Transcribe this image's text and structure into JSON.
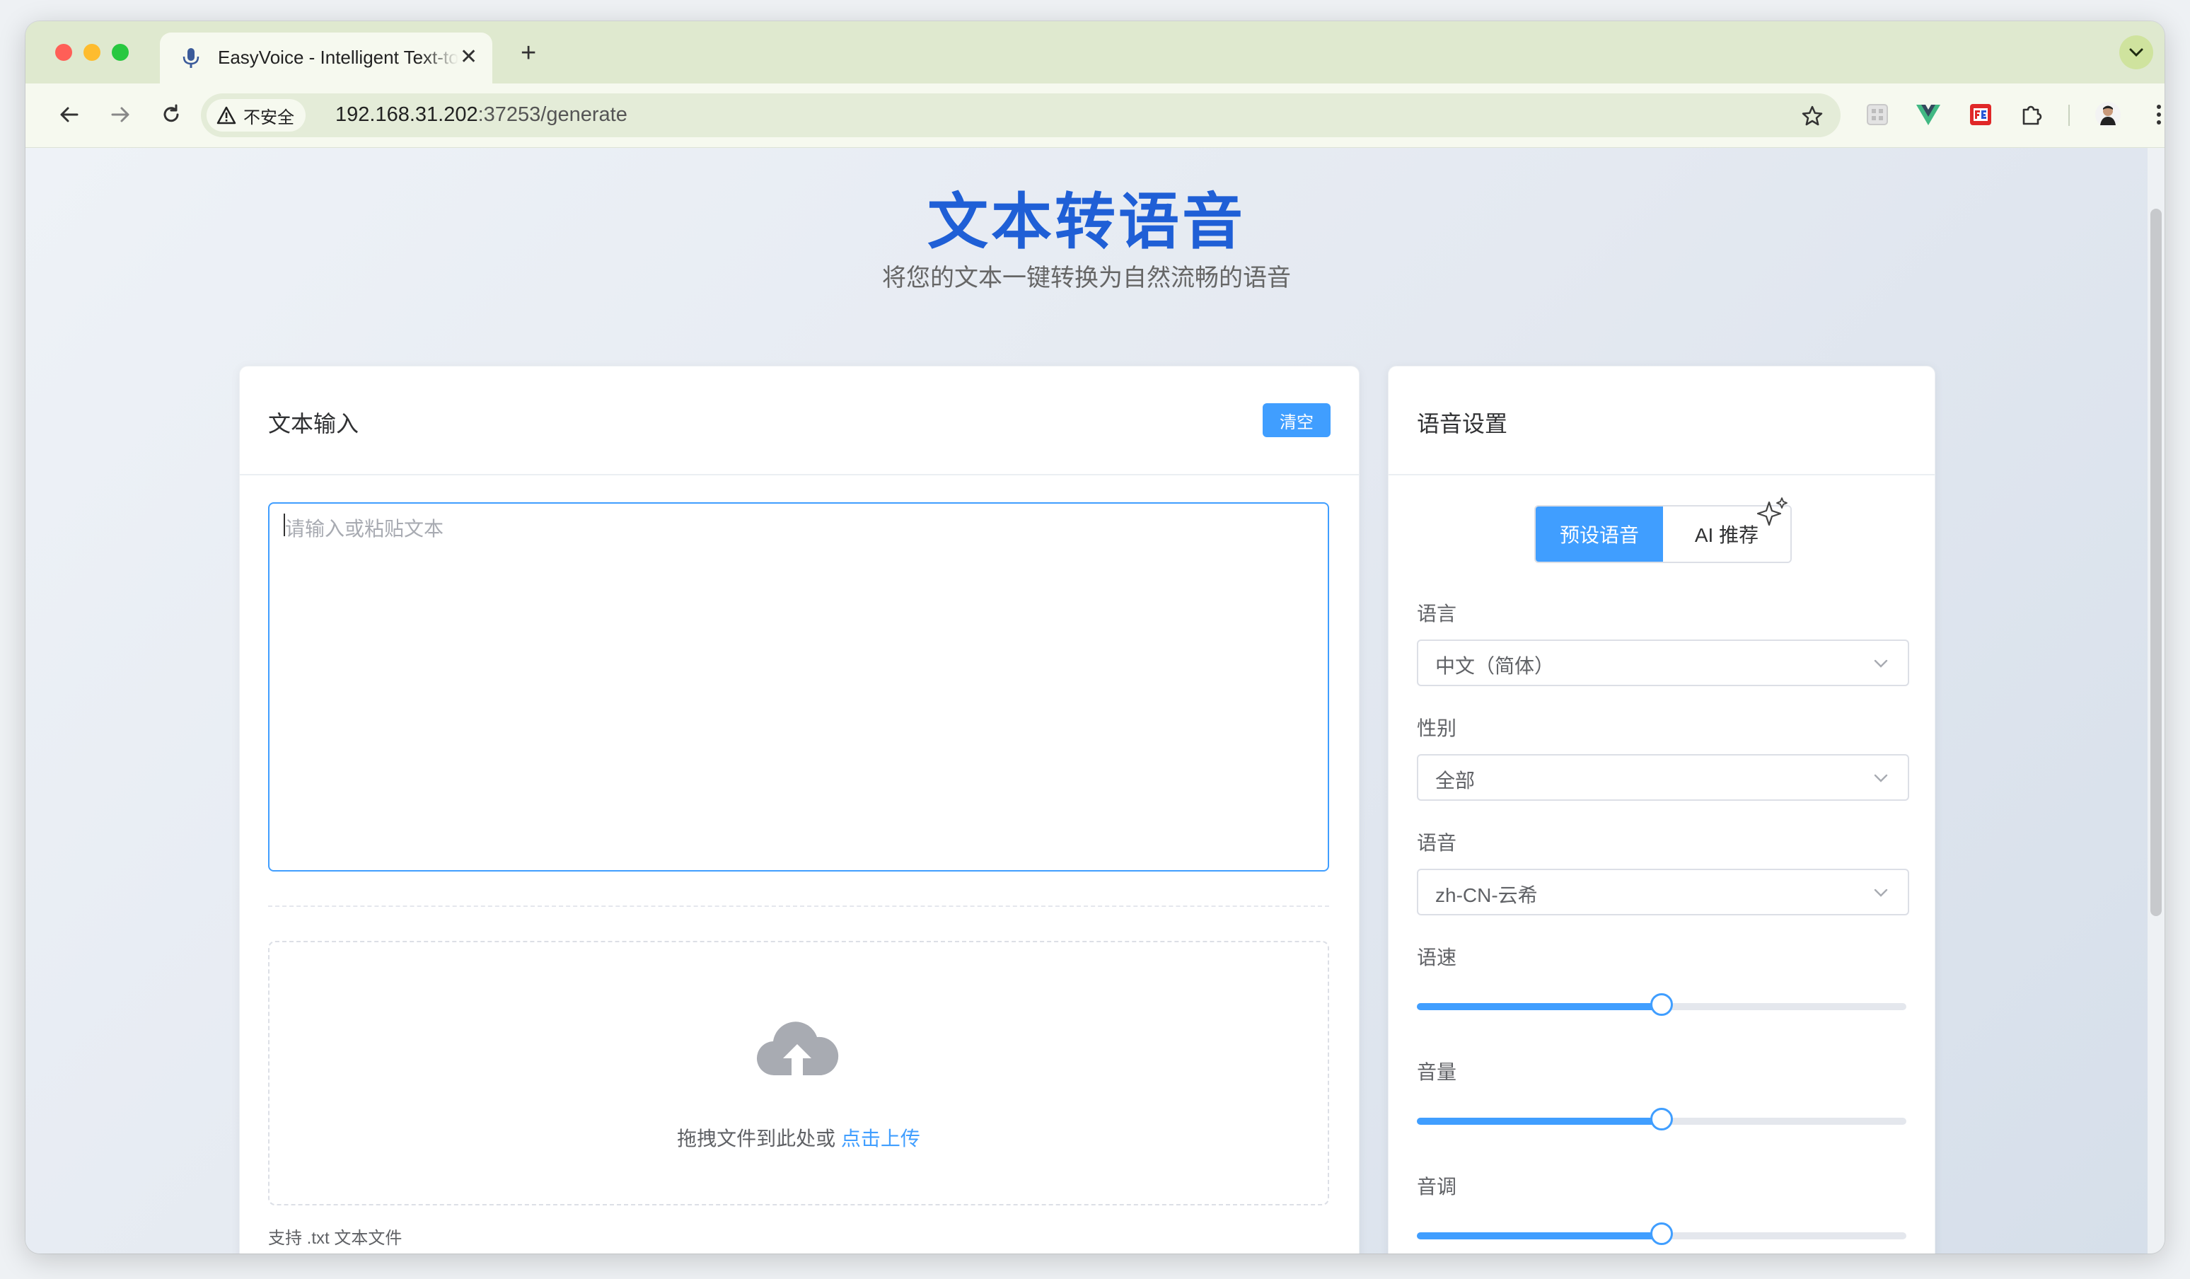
{
  "browser": {
    "tab_title": "EasyVoice - Intelligent Text-to-Speech",
    "new_tab_label": "+",
    "security_label": "不安全",
    "url_host": "192.168.31.202",
    "url_path": ":37253/generate"
  },
  "page": {
    "title": "文本转语音",
    "subtitle": "将您的文本一键转换为自然流畅的语音"
  },
  "text_input": {
    "header": "文本输入",
    "clear_label": "清空",
    "placeholder": "请输入或粘贴文本",
    "upload_prompt": "拖拽文件到此处或 ",
    "upload_link": "点击上传",
    "upload_tip": "支持 .txt 文本文件"
  },
  "voice_settings": {
    "header": "语音设置",
    "tabs": [
      {
        "label": "预设语音",
        "active": true
      },
      {
        "label": "AI 推荐",
        "active": false
      }
    ],
    "language": {
      "label": "语言",
      "value": "中文（简体）"
    },
    "gender": {
      "label": "性别",
      "value": "全部"
    },
    "voice": {
      "label": "语音",
      "value": "zh-CN-云希"
    },
    "rate": {
      "label": "语速",
      "fraction": 0.5
    },
    "volume": {
      "label": "音量",
      "fraction": 0.5
    },
    "pitch": {
      "label": "音调",
      "fraction": 0.5
    }
  },
  "colors": {
    "accent": "#409eff",
    "title": "#1f5fd6"
  }
}
